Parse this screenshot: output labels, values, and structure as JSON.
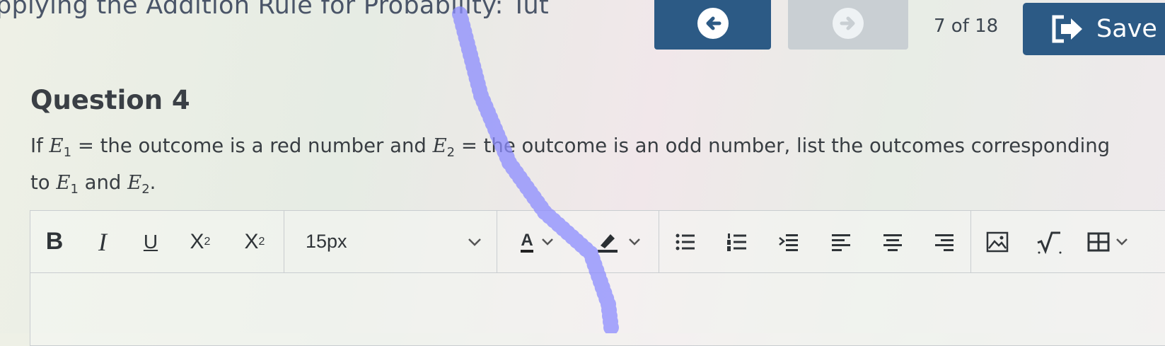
{
  "header": {
    "title": "pplying the Addition Rule for Probability: Tut",
    "page_count": "7 of 18",
    "save_label": "Save",
    "prev_icon": "arrow-left-icon",
    "next_icon": "arrow-right-icon"
  },
  "question": {
    "title": "Question 4",
    "line1_prefix": "If ",
    "e1": "E",
    "e1_sub": "1",
    "line1_mid": " = the outcome is a red number and ",
    "e2": "E",
    "e2_sub": "2",
    "line1_suffix": " = the outcome is an odd number, list the outcomes corresponding",
    "line2_prefix": "to ",
    "line2_mid": " and ",
    "line2_suffix": "."
  },
  "toolbar": {
    "bold": "B",
    "italic": "I",
    "underline": "U",
    "superscript_base": "X",
    "superscript_exp": "2",
    "subscript_base": "X",
    "subscript_idx": "2",
    "font_size": "15px",
    "font_color_letter": "A"
  },
  "colors": {
    "primary_button": "#2c5a85",
    "disabled_button": "#c9cfd3",
    "doodle": "#8c8cff"
  }
}
